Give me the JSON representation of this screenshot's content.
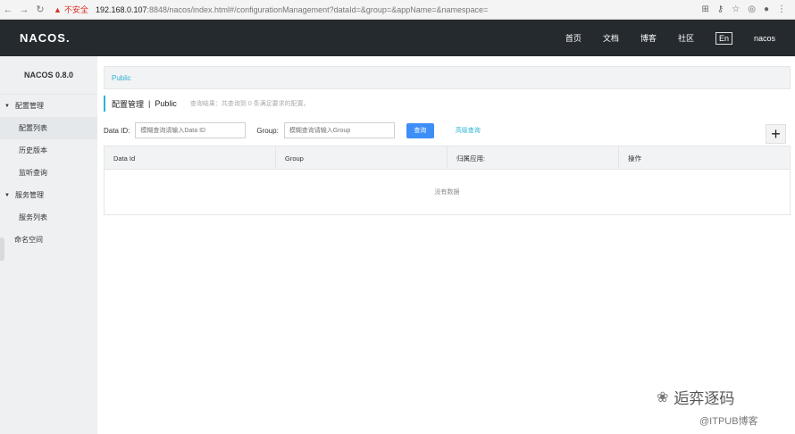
{
  "browser": {
    "insecure_label": "不安全",
    "url_host": "192.168.0.107",
    "url_rest": ":8848/nacos/index.html#/configurationManagement?dataId=&group=&appName=&namespace="
  },
  "header": {
    "logo": "NACOS.",
    "nav": [
      "首页",
      "文档",
      "博客",
      "社区"
    ],
    "lang": "En",
    "user": "nacos"
  },
  "sidebar": {
    "version": "NACOS 0.8.0",
    "group1": "配置管理",
    "items1": [
      "配置列表",
      "历史版本",
      "监听查询"
    ],
    "group2": "服务管理",
    "items2": [
      "服务列表"
    ],
    "namespace": "命名空间"
  },
  "main": {
    "breadcrumb": "Public",
    "title": "配置管理",
    "sep": "|",
    "namespace": "Public",
    "hint": "查询结果：共查询到 0 条满足要求的配置。",
    "dataid_label": "Data ID:",
    "dataid_placeholder": "模糊查询请输入Data ID",
    "group_label": "Group:",
    "group_placeholder": "模糊查询请输入Group",
    "query_button": "查询",
    "advanced": "高级查询",
    "add_symbol": "+",
    "columns": [
      "Data Id",
      "Group",
      "归属应用:",
      "操作"
    ],
    "empty": "没有数据"
  },
  "watermark": {
    "line1": "逅弈逐码",
    "line2": "@ITPUB博客"
  }
}
